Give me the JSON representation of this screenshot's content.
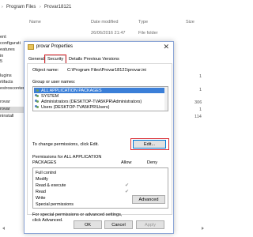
{
  "explorer": {
    "breadcrumb": [
      "Program Files",
      "Provar18121"
    ],
    "columns": {
      "name": "Name",
      "date": "Date modified",
      "type": "Type",
      "size": "Size"
    },
    "first_row": {
      "date": "26/06/2016 21:47",
      "type": "File folder"
    },
    "left_items": [
      "ent",
      "configurati",
      "eatures",
      "in",
      "5",
      "lugins",
      "rtifacts",
      "estroscontent",
      "rovar",
      "rovar",
      "ninstall"
    ],
    "right_numbers": [
      "1",
      "1",
      "306",
      "1",
      "114"
    ]
  },
  "dialog": {
    "title": "provar Properties",
    "tabs": [
      "General",
      "Security",
      "Details",
      "Previous Versions"
    ],
    "object_name_label": "Object name:",
    "object_name_value": "C:\\Program Files\\Provar18121\\provar.ini",
    "group_label": "Group or user names:",
    "users": [
      "ALL APPLICATION PACKAGES",
      "SYSTEM",
      "Administrators (DESKTOP-TVA5KPR\\Administrators)",
      "Users (DESKTOP-TVA5KPR\\Users)"
    ],
    "change_text": "To change permissions, click Edit.",
    "edit_label": "Edit...",
    "perm_for_line1": "Permissions for ALL APPLICATION",
    "perm_for_line2": "PACKAGES",
    "allow_label": "Allow",
    "deny_label": "Deny",
    "permissions": [
      "Full control",
      "Modify",
      "Read & execute",
      "Read",
      "Write",
      "Special permissions"
    ],
    "allowed": [
      false,
      false,
      true,
      true,
      false,
      false
    ],
    "special_line1": "For special permissions or advanced settings,",
    "special_line2": "click Advanced.",
    "advanced_label": "Advanced",
    "ok_label": "OK",
    "cancel_label": "Cancel",
    "apply_label": "Apply",
    "check_glyph": "✔",
    "close_glyph": "✕",
    "crumb_sep": "›"
  },
  "colors": {
    "selection": "#3b7fd8",
    "highlight": "#d9262c",
    "dialog_border": "#8aa4d6"
  }
}
